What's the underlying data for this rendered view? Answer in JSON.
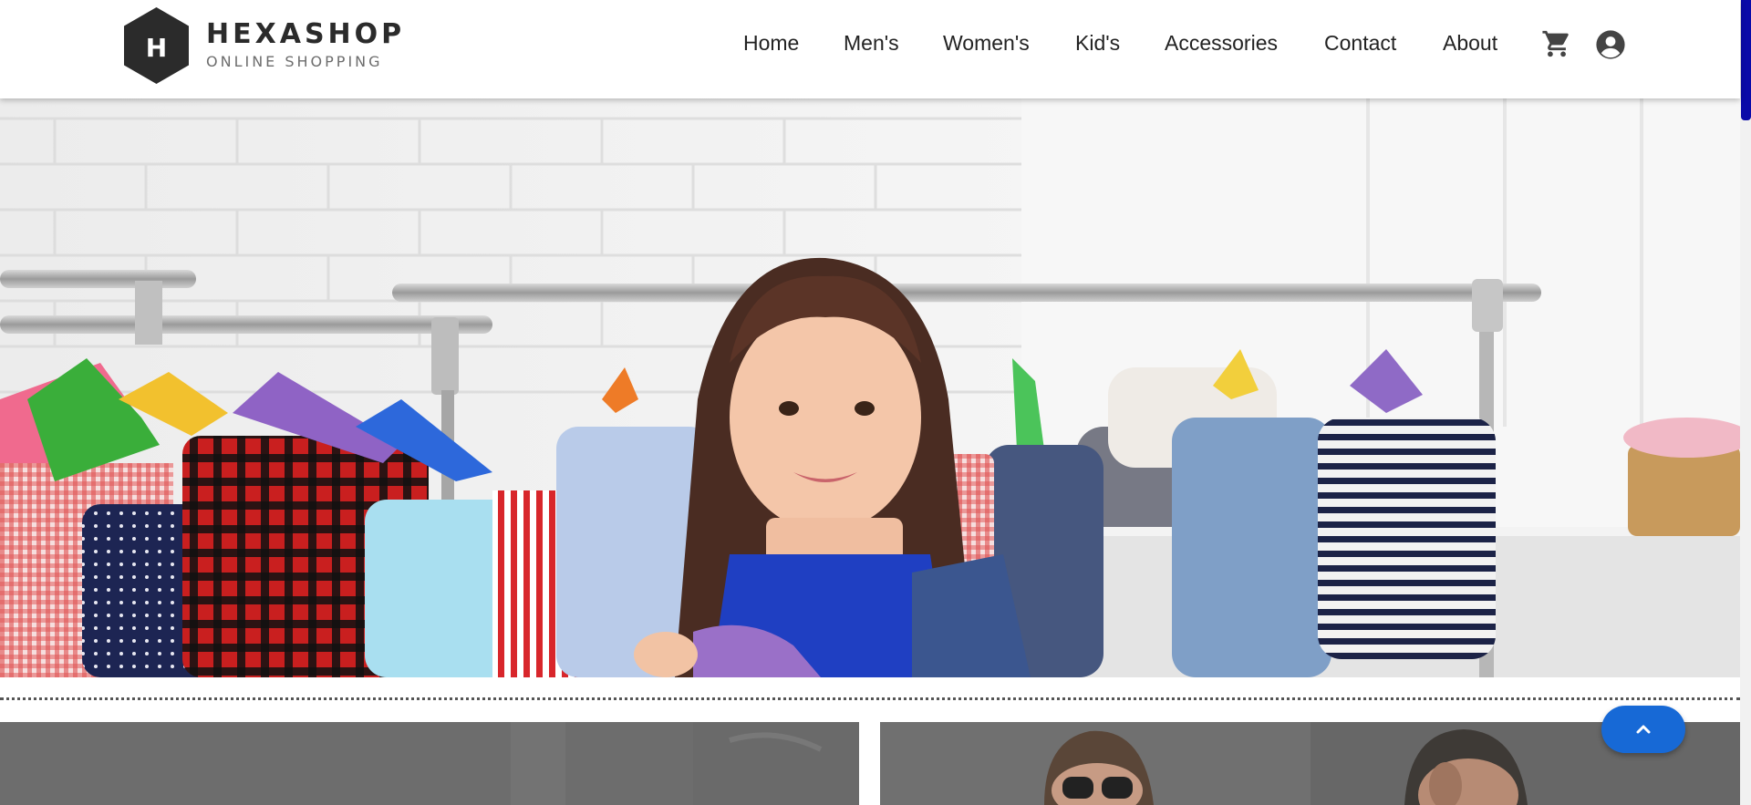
{
  "brand": {
    "logo_letter": "H",
    "name": "HEXASHOP",
    "tagline": "ONLINE SHOPPING"
  },
  "nav": {
    "items": [
      "Home",
      "Men's",
      "Women's",
      "Kid's",
      "Accessories",
      "Contact",
      "About"
    ],
    "icons": [
      "cart-icon",
      "account-icon"
    ]
  },
  "colors": {
    "accent": "#1769d6",
    "scrollbar": "#0a0aa8",
    "logo": "#2b2b2b"
  }
}
